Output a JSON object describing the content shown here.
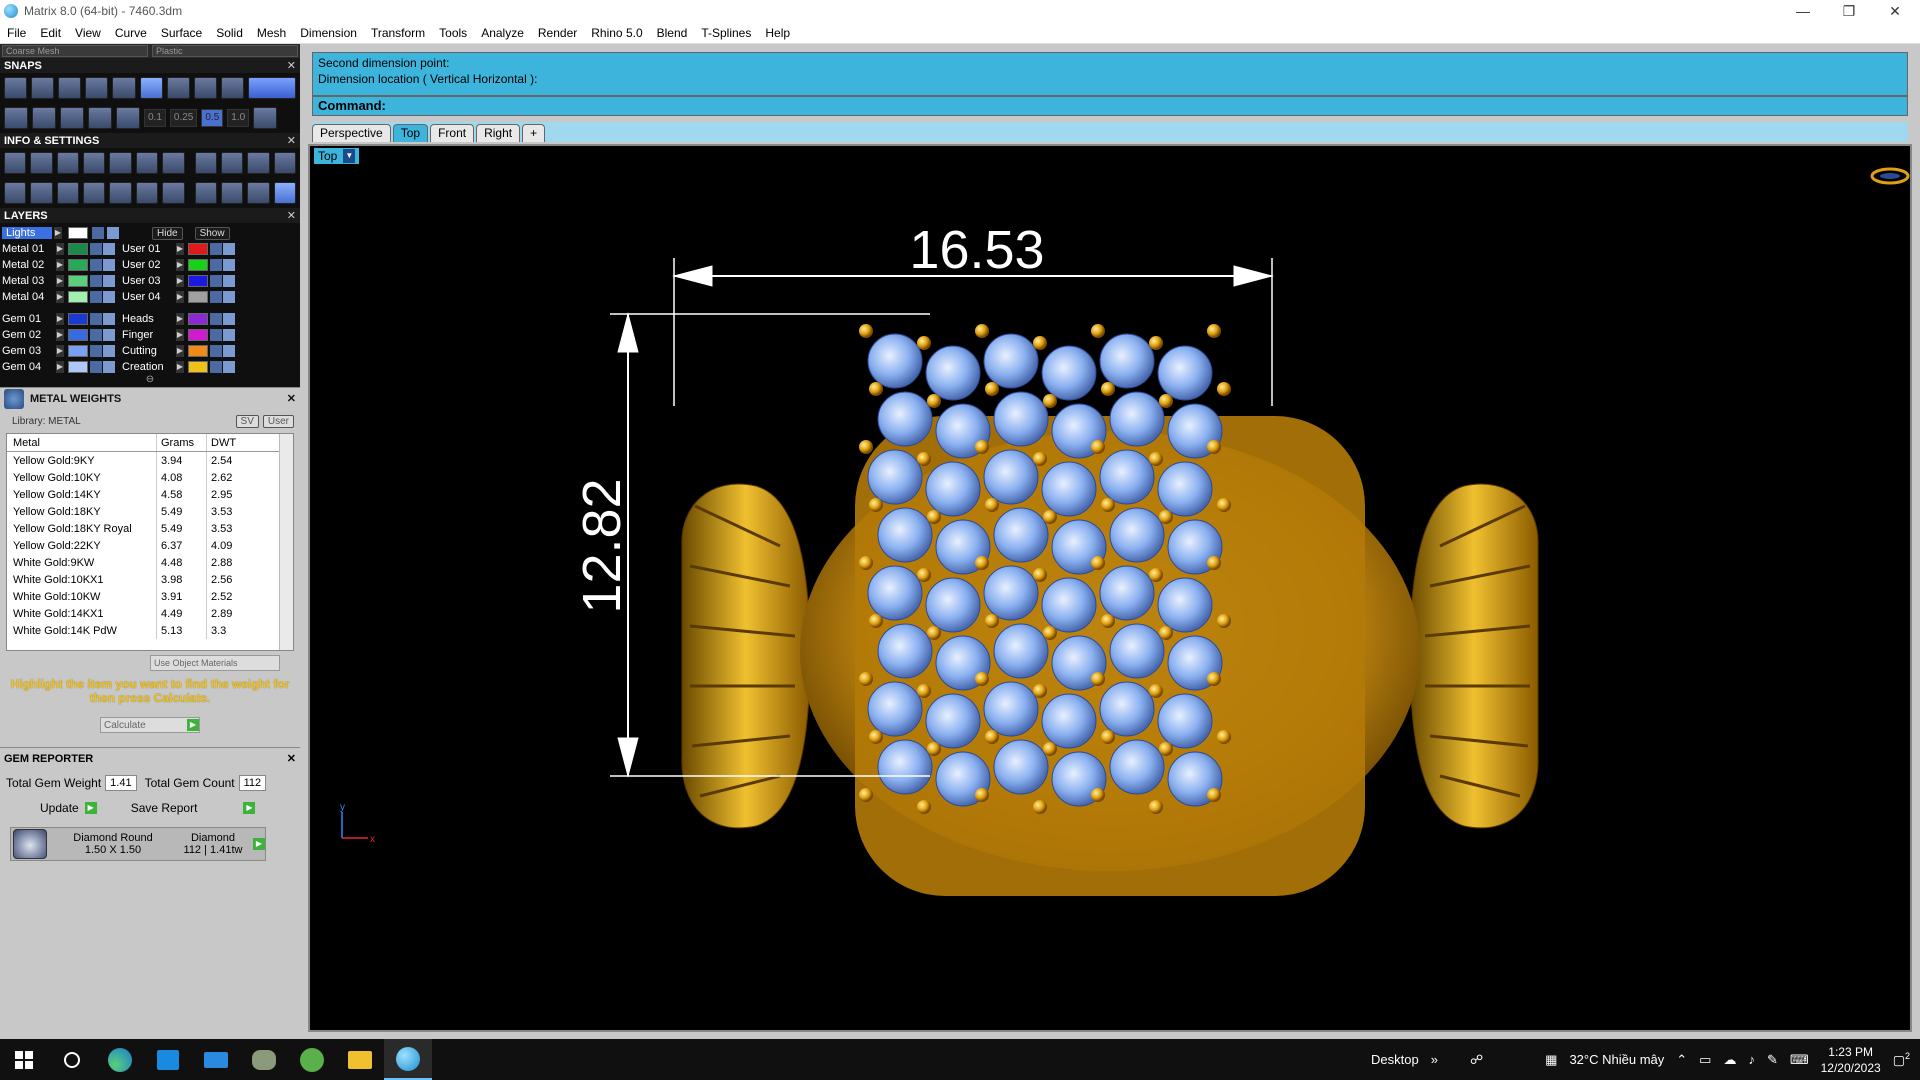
{
  "window": {
    "title": "Matrix 8.0 (64-bit) - 7460.3dm",
    "controls": [
      "—",
      "❐",
      "✕"
    ]
  },
  "menu": [
    "File",
    "Edit",
    "View",
    "Curve",
    "Surface",
    "Solid",
    "Mesh",
    "Dimension",
    "Transform",
    "Tools",
    "Analyze",
    "Render",
    "Rhino 5.0",
    "Blend",
    "T-Splines",
    "Help"
  ],
  "leftpanel": {
    "top_fields": [
      "Coarse Mesh",
      "Plastic"
    ],
    "snaps": {
      "title": "SNAPS",
      "values": [
        "0.1",
        "0.25",
        "0.5",
        "1.0"
      ]
    },
    "info": {
      "title": "INFO & SETTINGS"
    },
    "layers": {
      "title": "LAYERS",
      "lights_label": "Lights",
      "hide_label": "Hide",
      "show_label": "Show",
      "left": [
        {
          "name": "Metal 01",
          "color": "#1a8a4a"
        },
        {
          "name": "Metal 02",
          "color": "#2aa85a"
        },
        {
          "name": "Metal 03",
          "color": "#5ad07a"
        },
        {
          "name": "Metal 04",
          "color": "#a0f0b0"
        },
        {
          "name": "Gem 01",
          "color": "#1a3ad0"
        },
        {
          "name": "Gem 02",
          "color": "#3a6ae0"
        },
        {
          "name": "Gem 03",
          "color": "#7aa0f0"
        },
        {
          "name": "Gem 04",
          "color": "#b0c8f8"
        }
      ],
      "right": [
        {
          "name": "User 01",
          "color": "#e01a1a"
        },
        {
          "name": "User 02",
          "color": "#1ad01a"
        },
        {
          "name": "User 03",
          "color": "#1a1ae0"
        },
        {
          "name": "User 04",
          "color": "#a0a0a0"
        },
        {
          "name": "Heads",
          "color": "#8a2ad0"
        },
        {
          "name": "Finger",
          "color": "#d01ad0"
        },
        {
          "name": "Cutting",
          "color": "#f08a1a"
        },
        {
          "name": "Creation",
          "color": "#f0c01a"
        }
      ]
    },
    "metal_weights": {
      "title": "METAL WEIGHTS",
      "library": "Library: METAL",
      "sg_label": "SV",
      "user_label": "User",
      "columns": [
        "Metal",
        "Grams",
        "DWT"
      ],
      "rows": [
        [
          "Yellow Gold:9KY",
          "3.94",
          "2.54"
        ],
        [
          "Yellow Gold:10KY",
          "4.08",
          "2.62"
        ],
        [
          "Yellow Gold:14KY",
          "4.58",
          "2.95"
        ],
        [
          "Yellow Gold:18KY",
          "5.49",
          "3.53"
        ],
        [
          "Yellow Gold:18KY Royal",
          "5.49",
          "3.53"
        ],
        [
          "Yellow Gold:22KY",
          "6.37",
          "4.09"
        ],
        [
          "White Gold:9KW",
          "4.48",
          "2.88"
        ],
        [
          "White Gold:10KX1",
          "3.98",
          "2.56"
        ],
        [
          "White Gold:10KW",
          "3.91",
          "2.52"
        ],
        [
          "White Gold:14KX1",
          "4.49",
          "2.89"
        ],
        [
          "White Gold:14K PdW",
          "5.13",
          "3.3"
        ]
      ],
      "use_object_materials": "Use Object Materials",
      "hint": "Highlight the item you want to find the weight for then press Calculate.",
      "calculate": "Calculate"
    },
    "gem_reporter": {
      "title": "GEM REPORTER",
      "total_weight_label": "Total Gem Weight",
      "total_weight": "1.41",
      "total_count_label": "Total Gem Count",
      "total_count": "112",
      "update": "Update",
      "save_report": "Save Report",
      "gem_shape": "Diamond Round",
      "gem_size": "1.50 X 1.50",
      "gem_material": "Diamond",
      "gem_count": "112",
      "gem_weight": "1.41tw"
    }
  },
  "command": {
    "line1": "Second dimension point:",
    "line2": "Dimension location ( Vertical  Horizontal ):",
    "prompt": "Command:"
  },
  "view_tabs": [
    "Perspective",
    "Top",
    "Front",
    "Right",
    "+"
  ],
  "viewport": {
    "label": "Top",
    "dim_width": "16.53",
    "dim_height": "12.82",
    "axis_y": "y",
    "axis_x": "x"
  },
  "taskbar": {
    "desktop": "Desktop",
    "weather": "32°C  Nhiều mây",
    "time": "1:23 PM",
    "date": "12/20/2023",
    "notif_count": "2"
  }
}
